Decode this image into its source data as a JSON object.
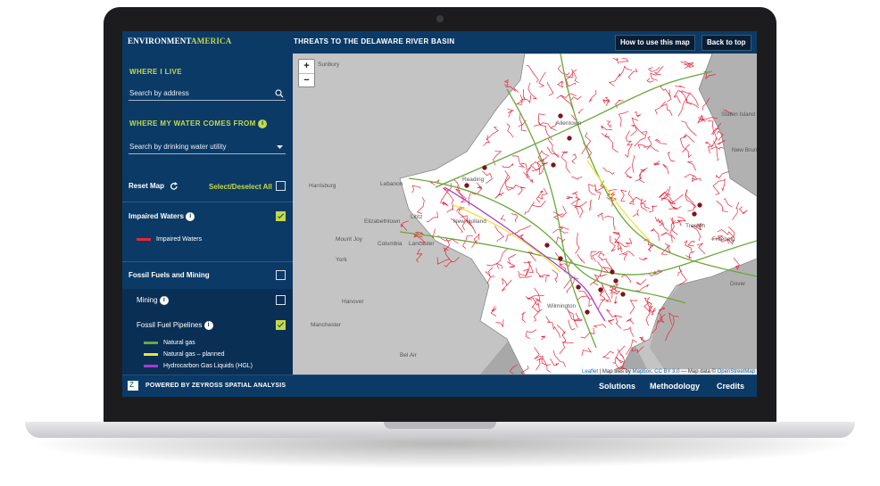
{
  "header": {
    "logo_main": "ENVIRONMENT",
    "logo_accent": "AMERICA",
    "title": "THREATS TO THE DELAWARE RIVER BASIN",
    "btn_howto": "How to use this map",
    "btn_top": "Back to top"
  },
  "sidebar": {
    "where_live": "WHERE I LIVE",
    "address_placeholder": "Search by address",
    "water_from": "WHERE MY WATER COMES FROM",
    "utility_placeholder": "Search by drinking water utility",
    "reset": "Reset Map",
    "select_all": "Select/Deselect All",
    "impaired_title": "Impaired Waters",
    "impaired_legend": "Impaired Waters",
    "fossil_title": "Fossil Fuels and Mining",
    "mining": "Mining",
    "pipelines": "Fossil Fuel Pipelines",
    "legend": [
      {
        "label": "Natural gas",
        "color": "#6aa83a"
      },
      {
        "label": "Natural gas – planned",
        "color": "#f2e23a"
      },
      {
        "label": "Hydrocarbon Gas Liquids (HGL)",
        "color": "#a23cd3"
      }
    ],
    "impaired_color": "#e8253a",
    "accent": "#c5d94a"
  },
  "map": {
    "zoom_in": "+",
    "zoom_out": "−",
    "attr_leaflet": "Leaflet",
    "attr_tiles": " | Map tiles by ",
    "attr_mapbox": "Mapbox",
    "attr_cc": "CC BY 3.0",
    "attr_data": " — Map data © ",
    "attr_osm": "OpenStreetMap",
    "place_labels": [
      "Sunbury",
      "Harrisburg",
      "Lebanon",
      "York",
      "Lancaster",
      "Lititz",
      "New Holland",
      "Columbia",
      "Mount Joy",
      "Elizabethtown",
      "Hanover",
      "Manchester",
      "Bel Air",
      "Allentown",
      "Reading",
      "Wilmington",
      "New Brunswick",
      "Trenton",
      "Staten Island",
      "Freehold",
      "Dover"
    ]
  },
  "footer": {
    "powered": "POWERED BY ZEYROSS SPATIAL ANALYSIS",
    "solutions": "Solutions",
    "methodology": "Methodology",
    "credits": "Credits"
  }
}
